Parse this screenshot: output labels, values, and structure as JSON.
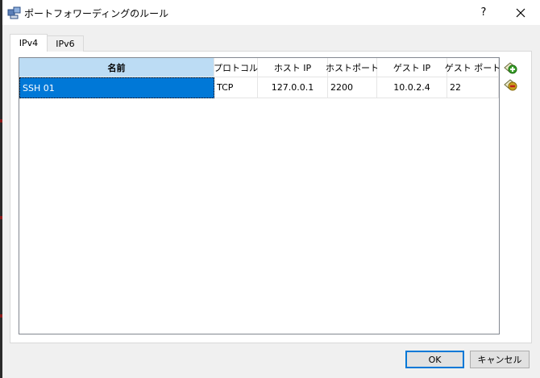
{
  "window": {
    "title": "ポートフォワーディングのルール",
    "help_label": "?"
  },
  "tabs": [
    {
      "label": "IPv4",
      "active": true
    },
    {
      "label": "IPv6",
      "active": false
    }
  ],
  "table": {
    "columns": [
      "名前",
      "プロトコル",
      "ホスト IP",
      "ホストポート",
      "ゲスト IP",
      "ゲスト ポート"
    ],
    "rows": [
      {
        "name": "SSH 01",
        "protocol": "TCP",
        "host_ip": "127.0.0.1",
        "host_port": "2200",
        "guest_ip": "10.0.2.4",
        "guest_port": "22"
      }
    ]
  },
  "side_buttons": {
    "add": "add-rule-icon",
    "remove": "remove-rule-icon"
  },
  "buttons": {
    "ok": "OK",
    "cancel": "キャンセル"
  },
  "colors": {
    "selection": "#0078d7",
    "sorted_header": "#bcdcf4",
    "add_icon": "#3aa02a",
    "remove_icon": "#c8a020"
  }
}
